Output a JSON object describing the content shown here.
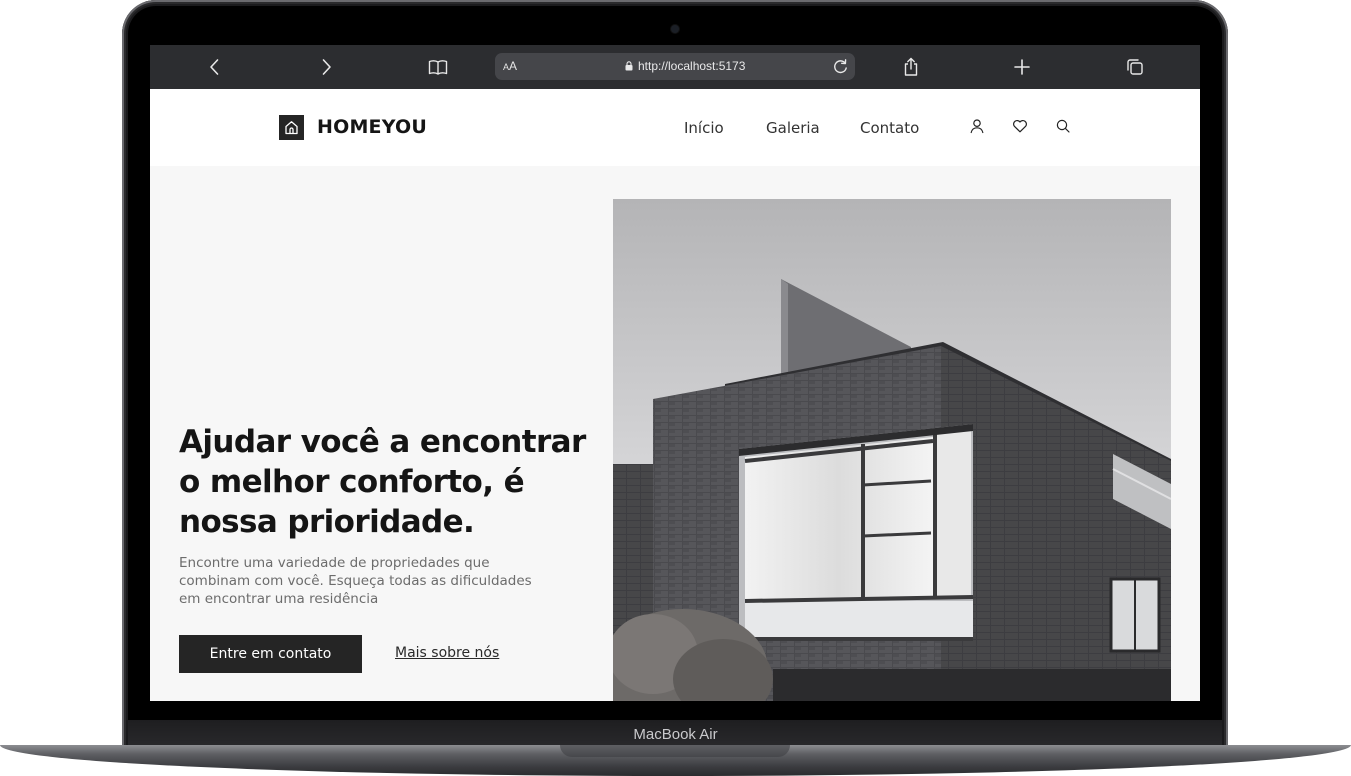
{
  "device": {
    "label": "MacBook Air"
  },
  "browser": {
    "text_size_label": "AA",
    "url": "http://localhost:5173",
    "icons": [
      "back-chevron-icon",
      "forward-chevron-icon",
      "bookmarks-book-icon",
      "lock-icon",
      "reload-icon",
      "share-icon",
      "new-tab-plus-icon",
      "tabs-overview-icon"
    ]
  },
  "site": {
    "brand": "HOMEYOU",
    "nav": [
      {
        "label": "Início"
      },
      {
        "label": "Galeria"
      },
      {
        "label": "Contato"
      }
    ],
    "header_icons": [
      "user-icon",
      "heart-icon",
      "search-icon"
    ]
  },
  "hero": {
    "title_lines": [
      "Ajudar você a encontrar",
      "o melhor conforto, é",
      "nossa prioridade."
    ],
    "subtitle_lines": [
      "Encontre uma variedade de propriedades que",
      "combinam com você. Esqueça todas as dificuldades",
      "em encontrar uma residência"
    ],
    "primary_button": "Entre em contato",
    "secondary_link": "Mais sobre nós"
  },
  "colors": {
    "toolbar_bg": "#2c2d30",
    "brand_dark": "#252525",
    "page_bg": "#f7f7f7"
  }
}
